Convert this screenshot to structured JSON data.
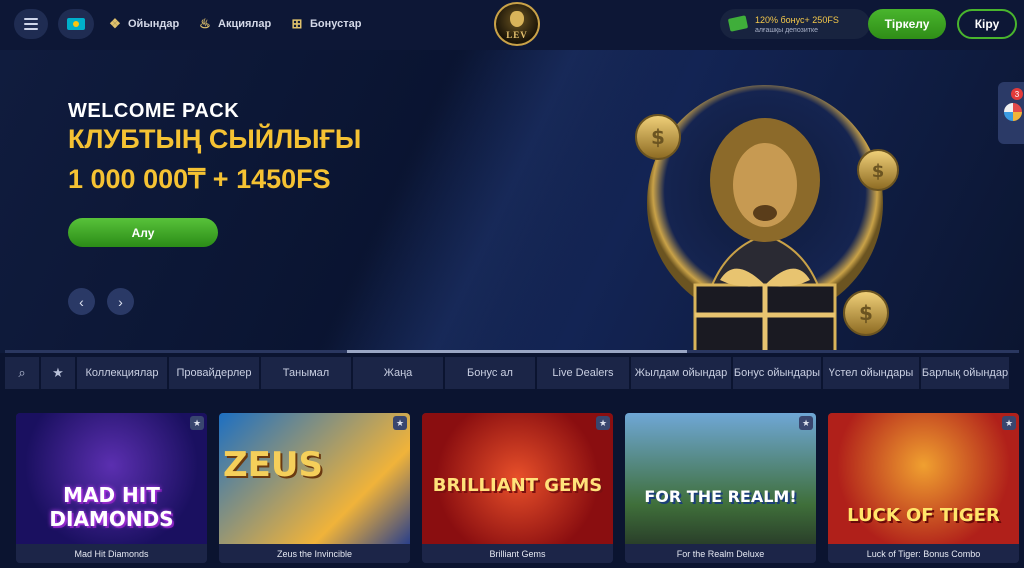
{
  "header": {
    "menu_icon": "hamburger-icon",
    "language_flag": "kazakhstan-flag",
    "nav": [
      {
        "label": "Ойындар",
        "icon": "dice-icon"
      },
      {
        "label": "Акциялар",
        "icon": "flame-icon"
      },
      {
        "label": "Бонустар",
        "icon": "gift-icon"
      }
    ],
    "logo_text": "LEV",
    "bonus": {
      "title": "120% бонус+ 250FS",
      "subtitle": "алғашқы депозитке",
      "icon": "money-icon"
    },
    "register_label": "Тіркелу",
    "login_label": "Кіру"
  },
  "hero": {
    "kicker": "WELCOME PACK",
    "line1": "КЛУБТЫҢ СЫЙЛЫҒЫ",
    "line2": "1 000 000₸ + 1450FS",
    "cta_label": "Алу",
    "prev_icon": "chevron-left-icon",
    "next_icon": "chevron-right-icon",
    "side_badge": "3"
  },
  "categories": {
    "search_icon": "search-icon",
    "favorites_icon": "star-icon",
    "items": [
      "Коллекциялар",
      "Провайдерлер",
      "Танымал",
      "Жаңа",
      "Бонус ал",
      "Live Dealers",
      "Жылдам ойындар",
      "Бонус ойындары",
      "Үстел ойындары",
      "Барлық ойындар"
    ]
  },
  "games": [
    {
      "name": "Mad Hit Diamonds",
      "art_title": "MAD HIT DIAMONDS"
    },
    {
      "name": "Zeus the Invincible",
      "art_title": "ZEUS"
    },
    {
      "name": "Brilliant Gems",
      "art_title": "BRILLIANT GEMS"
    },
    {
      "name": "For the Realm Deluxe",
      "art_title": "FOR THE REALM!"
    },
    {
      "name": "Luck of Tiger: Bonus Combo",
      "art_title": "LUCK OF TIGER"
    }
  ],
  "colors": {
    "accent_green": "#3a9e22",
    "gold": "#f5c233",
    "bg": "#0b1430"
  }
}
